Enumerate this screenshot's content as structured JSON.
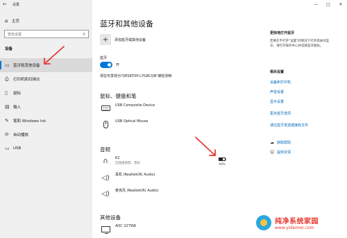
{
  "app": {
    "title": "设置",
    "back_icon": "back-arrow-icon"
  },
  "window_controls": {
    "minimize": "—",
    "maximize": "□",
    "close": "✕"
  },
  "sidebar": {
    "home_label": "主页",
    "search_placeholder": "查找设置",
    "section": "设备",
    "items": [
      {
        "label": "蓝牙和其他设备",
        "icon": "bluetooth-icon",
        "active": true
      },
      {
        "label": "打印机和扫描仪",
        "icon": "printer-icon"
      },
      {
        "label": "鼠标",
        "icon": "mouse-icon"
      },
      {
        "label": "输入",
        "icon": "keyboard-icon"
      },
      {
        "label": "笔和 Windows Ink",
        "icon": "pen-icon"
      },
      {
        "label": "自动播放",
        "icon": "autoplay-icon"
      },
      {
        "label": "USB",
        "icon": "usb-icon"
      }
    ]
  },
  "main": {
    "title": "蓝牙和其他设备",
    "add_device": "添加蓝牙或其他设备",
    "bluetooth": {
      "label": "蓝牙",
      "toggle_state": "开",
      "discoverable_text": "现在可发现为\"DESKTOP-L7G8CQN\"被检测到"
    },
    "mouse_keyboard_section": "鼠标、键盘和笔",
    "mouse_keyboard_devices": [
      {
        "name": "USB Composite Device"
      },
      {
        "name": "USB Optical Mouse"
      }
    ],
    "audio_section": "音频",
    "audio_devices": [
      {
        "name": "K2",
        "status": "已连接语音、音乐",
        "battery": "60%",
        "battery_level": 0.6
      },
      {
        "name": "耳机 (Realtek(R) Audio)"
      },
      {
        "name": "麦克风 (Realtek(R) Audio)"
      }
    ],
    "other_section": "其他设备",
    "other_devices": [
      {
        "name": "AOC 2279W"
      }
    ]
  },
  "right": {
    "faster_bt_head": "更快地打开蓝牙",
    "faster_bt_text": "若要在不打开\"设置\"的情况下打开或关闭蓝牙，请打开操作中心并选择蓝牙图标。",
    "related_head": "相关设置",
    "related_links": [
      "设备和打印机",
      "声音设置",
      "显示设置",
      "更多蓝牙选项",
      "通过蓝牙发送或接收文件"
    ],
    "help": [
      {
        "label": "获取帮助",
        "icon": "help-chat-icon"
      },
      {
        "label": "提供反馈",
        "icon": "feedback-icon"
      }
    ]
  },
  "watermark": {
    "title": "纯净系统家园",
    "url": "www.yidaimei.com"
  },
  "colors": {
    "accent": "#0078d7",
    "link": "#0067b8",
    "annotation": "#e53935"
  }
}
